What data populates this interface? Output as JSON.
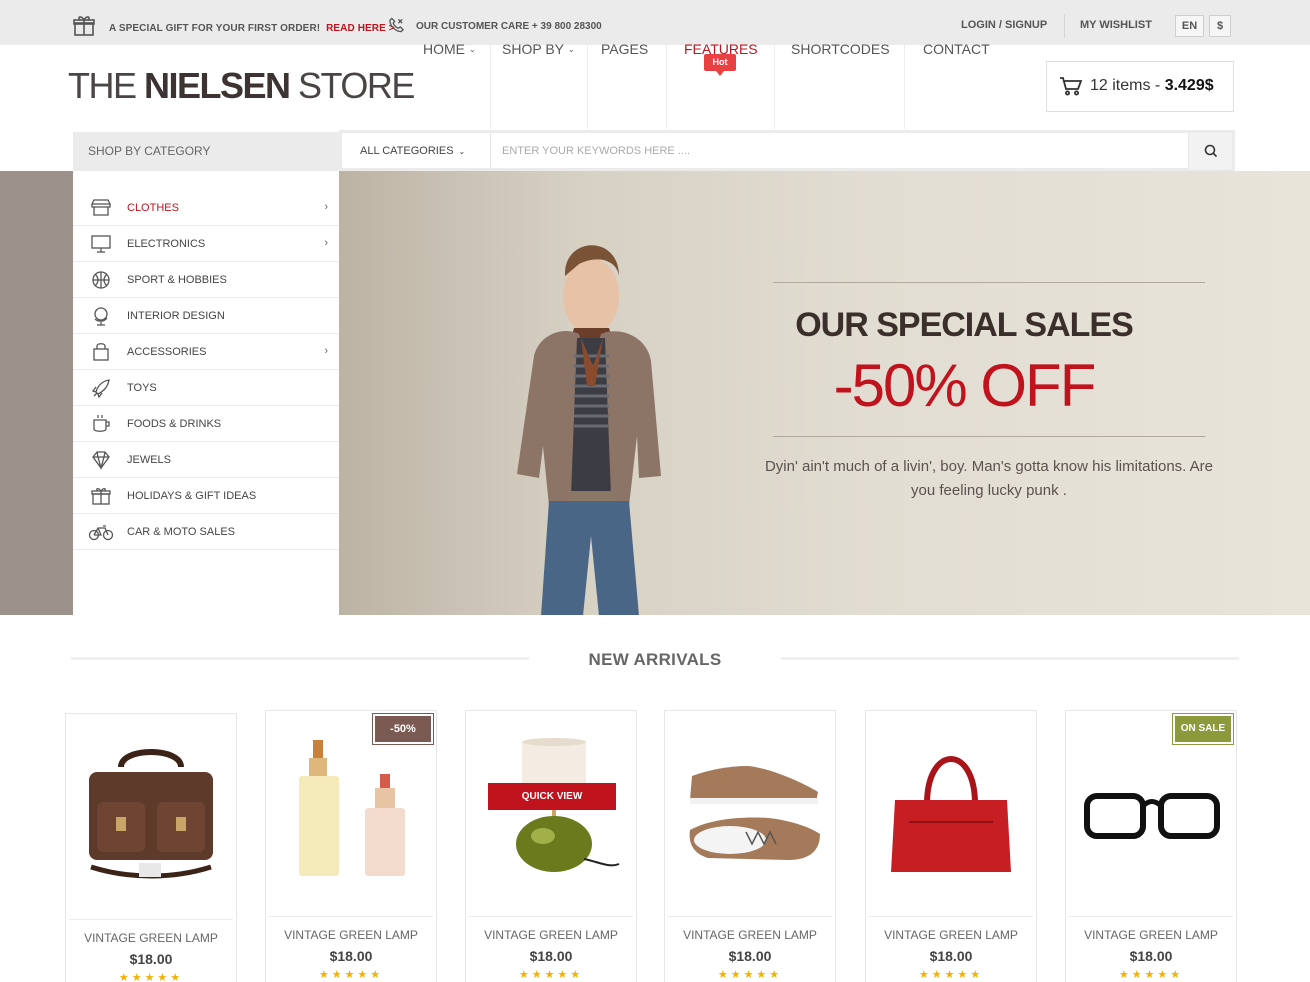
{
  "topbar": {
    "promo_text": "A SPECIAL GIFT FOR YOUR FIRST ORDER!",
    "promo_link": "READ HERE >",
    "customer_care": "OUR CUSTOMER CARE + 39 800 28300",
    "login": "LOGIN / SIGNUP",
    "wishlist": "MY WISHLIST",
    "language": "EN",
    "currency": "$"
  },
  "logo": {
    "light1": "THE ",
    "bold": "NIELSEN",
    "light2": " STORE"
  },
  "nav": {
    "items": [
      {
        "label": "HOME",
        "has_dropdown": true
      },
      {
        "label": "SHOP BY",
        "has_dropdown": true
      },
      {
        "label": "PAGES",
        "has_dropdown": false
      },
      {
        "label": "FEATURES",
        "has_dropdown": false,
        "active": true
      },
      {
        "label": "SHORTCODES",
        "has_dropdown": false
      },
      {
        "label": "CONTACT",
        "has_dropdown": false
      }
    ],
    "hot_badge": "Hot"
  },
  "cart": {
    "items": "12 items - ",
    "total": "3.429$"
  },
  "search": {
    "category_label": "SHOP BY CATEGORY",
    "all_categories": "ALL CATEGORIES",
    "placeholder": "ENTER YOUR KEYWORDS HERE ...."
  },
  "categories": [
    {
      "label": "CLOTHES",
      "icon": "store-icon",
      "arrow": true,
      "active": true
    },
    {
      "label": "ELECTRONICS",
      "icon": "monitor-icon",
      "arrow": true
    },
    {
      "label": "SPORT & HOBBIES",
      "icon": "basketball-icon",
      "arrow": false
    },
    {
      "label": "INTERIOR DESIGN",
      "icon": "globe-icon",
      "arrow": false
    },
    {
      "label": "ACCESSORIES",
      "icon": "bag-icon",
      "arrow": true
    },
    {
      "label": "TOYS",
      "icon": "rocket-icon",
      "arrow": false
    },
    {
      "label": "FOODS & DRINKS",
      "icon": "cup-icon",
      "arrow": false
    },
    {
      "label": "JEWELS",
      "icon": "diamond-icon",
      "arrow": false
    },
    {
      "label": "HOLIDAYS & GIFT IDEAS",
      "icon": "gift-icon",
      "arrow": false
    },
    {
      "label": "CAR & MOTO SALES",
      "icon": "bicycle-icon",
      "arrow": false
    }
  ],
  "hero": {
    "title": "OUR SPECIAL SALES",
    "discount": "-50% OFF",
    "subtitle": "Dyin' ain't much of a livin', boy. Man's gotta know his limitations. Are you feeling lucky punk ."
  },
  "new_arrivals": {
    "title": "NEW ARRIVALS",
    "products": [
      {
        "name": "VINTAGE GREEN LAMP",
        "price": "$18.00",
        "image": "leather-bag",
        "rating": 5,
        "badge": ""
      },
      {
        "name": "VINTAGE GREEN LAMP",
        "price": "$18.00",
        "image": "perfume-bottles",
        "rating": 5,
        "badge": "-50%"
      },
      {
        "name": "VINTAGE GREEN LAMP",
        "price": "$18.00",
        "image": "green-lamp",
        "rating": 5,
        "badge": "",
        "quick_view": "QUICK VIEW"
      },
      {
        "name": "VINTAGE GREEN LAMP",
        "price": "$18.00",
        "image": "sneakers",
        "rating": 5,
        "badge": ""
      },
      {
        "name": "VINTAGE GREEN LAMP",
        "price": "$18.00",
        "image": "red-handbag",
        "rating": 5,
        "badge": ""
      },
      {
        "name": "VINTAGE GREEN LAMP",
        "price": "$18.00",
        "image": "glasses",
        "rating": 5,
        "badge": "ON SALE"
      }
    ]
  },
  "colors": {
    "accent": "#c0131d",
    "hero_bg": "#e2ddd2",
    "topbar_bg": "#ebebeb",
    "star": "#f5b100"
  }
}
